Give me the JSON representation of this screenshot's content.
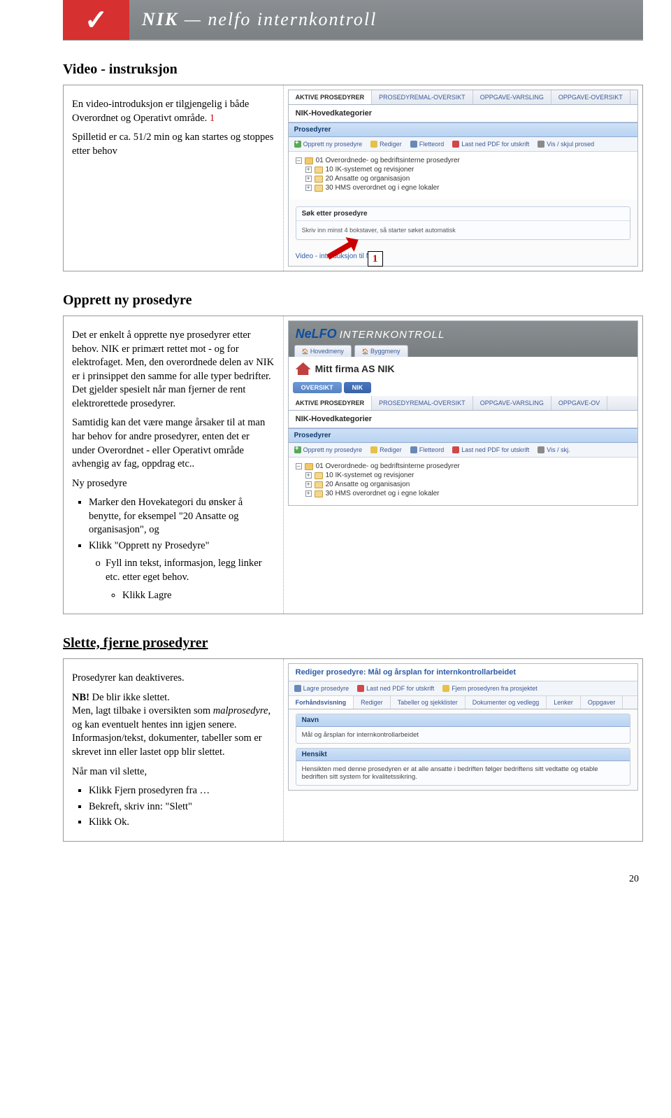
{
  "banner": {
    "brand_left": "NIK",
    "brand_right": "nelfo internkontroll"
  },
  "section1": {
    "title": "Video - instruksjon",
    "p1a": "En video-introduksjon er tilgjengelig i både Overordnet og Operativt område. ",
    "p1_num": "1",
    "p2": "Spilletid er ca. 51/2 min og kan startes og stoppes etter behov",
    "callout": "1",
    "app": {
      "tabs": [
        "AKTIVE PROSEDYRER",
        "PROSEDYREMAL-OVERSIKT",
        "OPPGAVE-VARSLING",
        "OPPGAVE-OVERSIKT"
      ],
      "heading": "NIK-Hovedkategorier",
      "panel": "Prosedyrer",
      "toolbar": {
        "new": "Opprett ny prosedyre",
        "edit": "Rediger",
        "move": "Fletteord",
        "pdf": "Last ned PDF for utskrift",
        "hide": "Vis / skjul prosed"
      },
      "tree": {
        "root": "01 Overordnede- og bedriftsinterne prosedyrer",
        "n1": "10 IK-systemet og revisjoner",
        "n2": "20 Ansatte og organisasjon",
        "n3": "30 HMS overordnet og i egne lokaler"
      },
      "search": {
        "title": "Søk etter prosedyre",
        "hint": "Skriv inn minst 4 bokstaver, så starter søket automatisk"
      },
      "videolink": "Video - introduksjon til NIK"
    }
  },
  "section2": {
    "title": "Opprett ny prosedyre",
    "p1": "Det er enkelt å opprette nye prosedyrer etter behov. NIK er primært rettet mot - og for elektrofaget. Men, den overordnede delen av NIK er i prinsippet den samme for alle typer bedrifter. Det gjelder spesielt når man fjerner de rent elektrorettede prosedyrer.",
    "p2": "Samtidig kan det være mange årsaker til at man har behov for andre prosedyrer, enten det er under Overordnet - eller Operativt område avhengig av fag, oppdrag etc..",
    "p3": "Ny prosedyre",
    "li1": "Marker den Hovekategori du ønsker å benytte, for eksempel \"20 Ansatte og organisasjon\", og",
    "li2": "Klikk \"Opprett ny Prosedyre\"",
    "li2a": "Fyll inn tekst, informasjon, legg linker etc. etter eget behov.",
    "li2b": "Klikk Lagre",
    "app": {
      "nelfo": "NeLFO",
      "ik": "INTERNKONTROLL",
      "menu1": "Hovedmeny",
      "menu2": "Byggmeny",
      "firma": "Mitt firma AS NIK",
      "pill1": "OVERSIKT",
      "pill2": "NIK",
      "tabs": [
        "AKTIVE PROSEDYRER",
        "PROSEDYREMAL-OVERSIKT",
        "OPPGAVE-VARSLING",
        "OPPGAVE-OV"
      ],
      "heading": "NIK-Hovedkategorier",
      "panel": "Prosedyrer",
      "toolbar": {
        "new": "Opprett ny prosedyre",
        "edit": "Rediger",
        "move": "Fletteord",
        "pdf": "Last ned PDF for utskrift",
        "hide": "Vis / skj."
      },
      "tree": {
        "root": "01 Overordnede- og bedriftsinterne prosedyrer",
        "n1": "10 IK-systemet og revisjoner",
        "n2": "20 Ansatte og organisasjon",
        "n3": "30 HMS overordnet og i egne lokaler"
      }
    }
  },
  "section3": {
    "title": "Slette, fjerne prosedyrer",
    "p1": "Prosedyrer kan deaktiveres.",
    "nb": "NB!",
    "nb_rest": " De blir ikke slettet.",
    "p2a": "Men, lagt tilbake i oversikten som ",
    "p2i": "malprosedyre",
    "p2b": ", og kan eventuelt hentes inn igjen senere.",
    "p3": "Informasjon/tekst, dokumenter, tabeller som er skrevet inn eller lastet opp blir slettet.",
    "p4": "Når man vil slette,",
    "li1": "Klikk Fjern prosedyren fra …",
    "li2": "Bekreft, skriv inn: \"Slett\"",
    "li3": "Klikk Ok.",
    "app": {
      "title": "Rediger prosedyre: Mål og årsplan for internkontrollarbeidet",
      "toolbar": {
        "save": "Lagre prosedyre",
        "pdf": "Last ned PDF for utskrift",
        "remove": "Fjern prosedyren fra prosjektet"
      },
      "tabs": [
        "Forhåndsvisning",
        "Rediger",
        "Tabeller og sjekklister",
        "Dokumenter og vedlegg",
        "Lenker",
        "Oppgaver"
      ],
      "pane1": {
        "h": "Navn",
        "b": "Mål og årsplan for internkontrollarbeidet"
      },
      "pane2": {
        "h": "Hensikt",
        "b": "Hensikten med denne prosedyren er at alle ansatte i bedriften følger bedriftens sitt vedtatte og etable bedriften sitt system for kvalitetssikring."
      }
    }
  },
  "page_number": "20"
}
